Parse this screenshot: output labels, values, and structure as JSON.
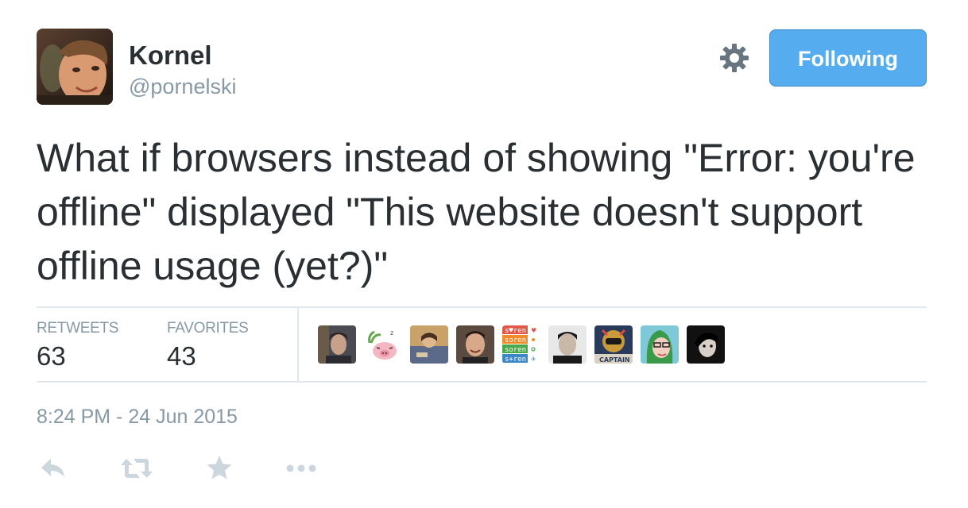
{
  "author": {
    "name": "Kornel",
    "handle": "@pornelski"
  },
  "follow_button": {
    "label": "Following"
  },
  "tweet": {
    "text": "What if browsers instead of showing \"Error: you're offline\" displayed \"This website doesn't support offline usage (yet?)\""
  },
  "stats": {
    "retweets": {
      "label": "RETWEETS",
      "value": "63"
    },
    "favorites": {
      "label": "FAVORITES",
      "value": "43"
    }
  },
  "favoriters": {
    "soren_lines": [
      "s♥ren",
      "soren",
      "soren",
      "s+ren"
    ],
    "avatar_label_captain": "CAPTAIN"
  },
  "timestamp": "8:24 PM - 24 Jun 2015",
  "colors": {
    "accent": "#55acee",
    "text": "#292f33",
    "muted": "#8899a6",
    "divider": "#e1e8ed",
    "icon": "#ccd6dd"
  },
  "icons": {
    "settings": "gear-icon",
    "reply": "reply-icon",
    "retweet": "retweet-icon",
    "favorite": "star-icon",
    "more": "more-icon"
  }
}
